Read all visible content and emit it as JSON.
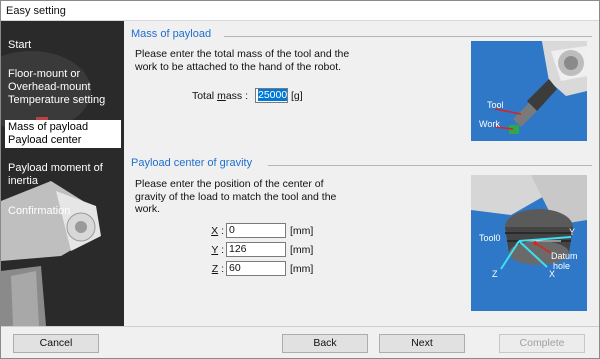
{
  "window": {
    "title": "Easy setting"
  },
  "sidebar": {
    "items": [
      {
        "label": "Start"
      },
      {
        "label": "Floor-mount or\nOverhead-mount\nTemperature setting"
      },
      {
        "label": "Mass of payload\nPayload center"
      },
      {
        "label": "Payload moment of\ninertia"
      },
      {
        "label": "Confirmation"
      }
    ],
    "active_index": 2
  },
  "mass": {
    "title": "Mass of payload",
    "description": "Please enter the total mass of the tool and the work to be attached to the hand of the robot.",
    "label_prefix": "Total ",
    "label_hotkey": "m",
    "label_suffix": "ass :",
    "value": "25000",
    "unit": "[g]",
    "illustration": {
      "tool_label": "Tool",
      "work_label": "Work"
    }
  },
  "center": {
    "title": "Payload center of gravity",
    "description": "Please enter the position of the center of gravity of the load to match the tool and the work.",
    "fields": [
      {
        "hotkey": "X",
        "suffix": " :",
        "value": "0",
        "unit": "[mm]"
      },
      {
        "hotkey": "Y",
        "suffix": " :",
        "value": "126",
        "unit": "[mm]"
      },
      {
        "hotkey": "Z",
        "suffix": " :",
        "value": "60",
        "unit": "[mm]"
      }
    ],
    "illustration": {
      "tool0_label": "Tool0",
      "y_label": "Y",
      "z_label": "Z",
      "x_label": "X",
      "datum_label_1": "Datum",
      "datum_label_2": "hole"
    }
  },
  "buttons": {
    "cancel": "Cancel",
    "back": "Back",
    "next": "Next",
    "complete": "Complete"
  },
  "colors": {
    "accent": "#1e6fd0",
    "illustration_bg": "#2e78c7",
    "sidebar_bg": "#2b2b2b"
  }
}
